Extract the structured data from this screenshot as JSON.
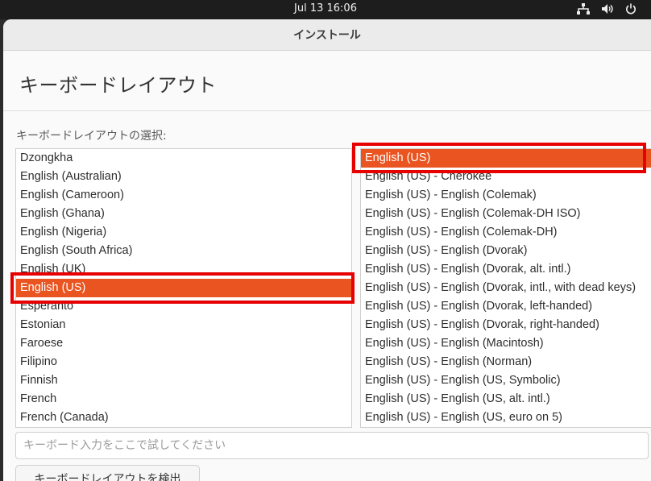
{
  "topbar": {
    "clock": "Jul 13  16:06"
  },
  "window": {
    "title": "インストール"
  },
  "page": {
    "title": "キーボードレイアウト",
    "select_label": "キーボードレイアウトの選択:"
  },
  "layouts": [
    {
      "label": "Dzongkha",
      "selected": false
    },
    {
      "label": "English (Australian)",
      "selected": false
    },
    {
      "label": "English (Cameroon)",
      "selected": false
    },
    {
      "label": "English (Ghana)",
      "selected": false
    },
    {
      "label": "English (Nigeria)",
      "selected": false
    },
    {
      "label": "English (South Africa)",
      "selected": false
    },
    {
      "label": "English (UK)",
      "selected": false
    },
    {
      "label": "English (US)",
      "selected": true
    },
    {
      "label": "Esperanto",
      "selected": false
    },
    {
      "label": "Estonian",
      "selected": false
    },
    {
      "label": "Faroese",
      "selected": false
    },
    {
      "label": "Filipino",
      "selected": false
    },
    {
      "label": "Finnish",
      "selected": false
    },
    {
      "label": "French",
      "selected": false
    },
    {
      "label": "French (Canada)",
      "selected": false
    }
  ],
  "variants": [
    {
      "label": "English (US)",
      "selected": true
    },
    {
      "label": "English (US) - Cherokee",
      "selected": false
    },
    {
      "label": "English (US) - English (Colemak)",
      "selected": false
    },
    {
      "label": "English (US) - English (Colemak-DH ISO)",
      "selected": false
    },
    {
      "label": "English (US) - English (Colemak-DH)",
      "selected": false
    },
    {
      "label": "English (US) - English (Dvorak)",
      "selected": false
    },
    {
      "label": "English (US) - English (Dvorak, alt. intl.)",
      "selected": false
    },
    {
      "label": "English (US) - English (Dvorak, intl., with dead keys)",
      "selected": false
    },
    {
      "label": "English (US) - English (Dvorak, left-handed)",
      "selected": false
    },
    {
      "label": "English (US) - English (Dvorak, right-handed)",
      "selected": false
    },
    {
      "label": "English (US) - English (Macintosh)",
      "selected": false
    },
    {
      "label": "English (US) - English (Norman)",
      "selected": false
    },
    {
      "label": "English (US) - English (US, Symbolic)",
      "selected": false
    },
    {
      "label": "English (US) - English (US, alt. intl.)",
      "selected": false
    },
    {
      "label": "English (US) - English (US, euro on 5)",
      "selected": false
    }
  ],
  "test_input": {
    "placeholder": "キーボード入力をここで試してください",
    "value": ""
  },
  "detect_button": {
    "label": "キーボードレイアウトを検出"
  },
  "colors": {
    "accent": "#e95420",
    "annotation": "#e60000"
  }
}
